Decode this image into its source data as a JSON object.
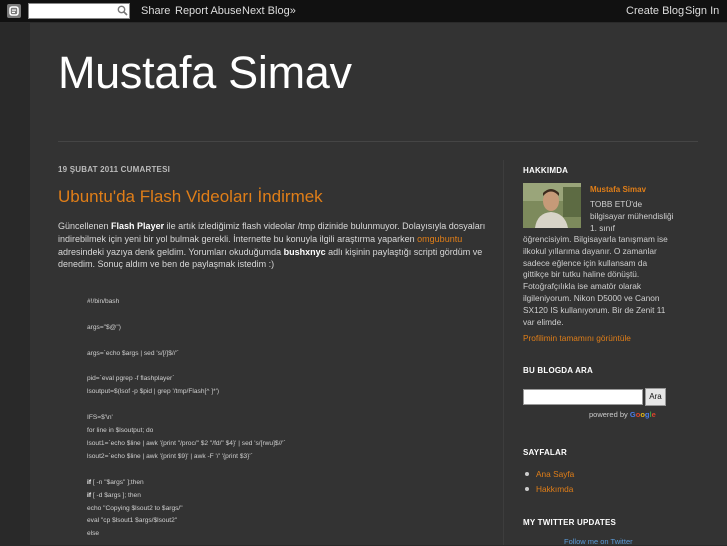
{
  "navbar": {
    "logo_icon": "blogger-icon",
    "search_placeholder": "",
    "search_icon": "search-icon",
    "share": "Share",
    "report_abuse": "Report Abuse",
    "next_blog": "Next Blog»",
    "create_blog": "Create Blog",
    "sign_in": "Sign In"
  },
  "header": {
    "title": "Mustafa Simav"
  },
  "post": {
    "date": "19 ŞUBAT 2011 CUMARTESI",
    "title": "Ubuntu'da Flash Videoları İndirmek",
    "p_part1": "Güncellenen ",
    "p_bold1": "Flash Player",
    "p_part2": " ile artık izlediğimiz flash videolar /tmp dizinide bulunmuyor. Dolayısıyla dosyaları indirebilmek için yeni bir yol bulmak gerekli. İnternette bu konuyla ilgili araştırma yaparken ",
    "p_link": "omgubuntu",
    "p_part3": " adresindeki yazıya denk geldim. Yorumları okuduğumda ",
    "p_bold2": "bushxnyc",
    "p_part4": " adlı kişinin paylaştığı scripti gördüm ve denedim. Sonuç aldım ve ben de paylaşmak istedim :)",
    "code": {
      "l1": "#!/bin/bash",
      "l2": "args=\"$@\")",
      "l3": "args=`echo $args | sed 's/[/]$//'`",
      "l4": "pid=`eval pgrep -f flashplayer`",
      "l5": "lsoutput=$(lsof -p $pid | grep '/tmp/Flash[^ ]*')",
      "l6": "IFS=$'\\n'",
      "l7": "for line in $lsoutput; do",
      "l8": "lsout1=`echo $line | awk '{print \"/proc/\" $2 \"/fd/\" $4}' | sed 's/[rwu]$//'`",
      "l9": "lsout2=`echo $line | awk '{print $9}' | awk -F '/' '{print $3}'`",
      "l10a": "if",
      "l10b": " [ -n \"$args\" ];then",
      "l11a": "if",
      "l11b": " [ -d $args ]; then",
      "l12": "echo \"Copying $lsout2 to $args/\"",
      "l13": "eval \"cp $lsout1 $args/$lsout2\"",
      "l14": "else"
    }
  },
  "sidebar": {
    "about": {
      "heading": "HAKKIMDA",
      "name": "Mustafa Simav",
      "text_short": "TOBB ETÜ'de bilgisayar mühendisliği 1. sınıf",
      "text_long": "öğrencisiyim. Bilgisayarla tanışmam ise ilkokul yıllarıma dayanır. O zamanlar sadece eğlence için kullansam da gittikçe bir tutku haline dönüştü. Fotoğrafçılıkla ise amatör olarak ilgileniyorum. Nikon D5000 ve Canon SX120 IS kullanıyorum. Bir de Zenit 11 var elimde.",
      "profile_link": "Profilimin tamamını görüntüle"
    },
    "search": {
      "heading": "BU BLOGDA ARA",
      "button": "Ara",
      "powered_by": "powered by",
      "google": [
        "G",
        "o",
        "o",
        "g",
        "l",
        "e"
      ]
    },
    "pages": {
      "heading": "SAYFALAR",
      "items": [
        "Ana Sayfa",
        "Hakkımda"
      ]
    },
    "twitter": {
      "heading": "MY TWITTER UPDATES",
      "follow": "Follow me on Twitter"
    }
  },
  "colors": {
    "accent": "#e07e18",
    "background": "#292929",
    "panel": "#333333"
  }
}
